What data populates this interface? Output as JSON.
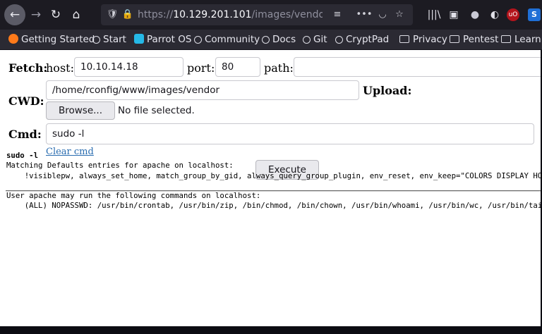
{
  "browser": {
    "url_prefix": "https://",
    "url_host": "10.129.201.101",
    "url_path": "/images/vendor/conn",
    "nav": {
      "back": "←",
      "forward": "→",
      "reload": "↻",
      "home": "⌂"
    },
    "urlbar_icons": {
      "shield": "🛡",
      "lock": "🔒",
      "reader": "≡",
      "more": "•••",
      "pocket": "◡",
      "star": "☆"
    },
    "toolbar_icons": {
      "library": "|||\\",
      "sidebar": "▣",
      "account": "●",
      "ext1": "◐",
      "ublock": "uO",
      "ext2": "S"
    }
  },
  "bookmarks": [
    {
      "label": "Getting Started",
      "icon": "firefox-icon"
    },
    {
      "label": "Start",
      "icon": "globe-icon"
    },
    {
      "label": "Parrot OS",
      "icon": "parrot-icon"
    },
    {
      "label": "Community",
      "icon": "globe-icon"
    },
    {
      "label": "Docs",
      "icon": "globe-icon"
    },
    {
      "label": "Git",
      "icon": "globe-icon"
    },
    {
      "label": "CryptPad",
      "icon": "globe-icon"
    },
    {
      "label": "Privacy",
      "icon": "folder-icon"
    },
    {
      "label": "Pentest",
      "icon": "folder-icon"
    },
    {
      "label": "Learn",
      "icon": "folder-icon"
    }
  ],
  "form": {
    "fetch_label": "Fetch:",
    "host_label": "host:",
    "host_value": "10.10.14.18",
    "port_label": "port:",
    "port_value": "80",
    "path_label": "path:",
    "path_value": "",
    "cwd_label": "CWD:",
    "cwd_value": "/home/rconfig/www/images/vendor",
    "upload_label": "Upload:",
    "browse_label": "Browse...",
    "file_status": "No file selected.",
    "cmd_label": "Cmd:",
    "cmd_value": "sudo -l",
    "clear_label": "Clear cmd",
    "execute_label": "Execute"
  },
  "output": {
    "command": "sudo -l",
    "lines": [
      "Matching Defaults entries for apache on localhost:",
      "    !visiblepw, always_set_home, match_group_by_gid, always_query_group_plugin, env_reset, env_keep=\"COLORS DISPLAY HOSTNAME",
      "",
      "User apache may run the following commands on localhost:",
      "    (ALL) NOPASSWD: /usr/bin/crontab, /usr/bin/zip, /bin/chmod, /bin/chown, /usr/bin/whoami, /usr/bin/wc, /usr/bin/tail, /bin/rm"
    ]
  },
  "colors": {
    "toolbar": "#1c1b22",
    "bookmarks": "#2b2a33",
    "link": "#2a6db0",
    "page": "#ffffff"
  }
}
